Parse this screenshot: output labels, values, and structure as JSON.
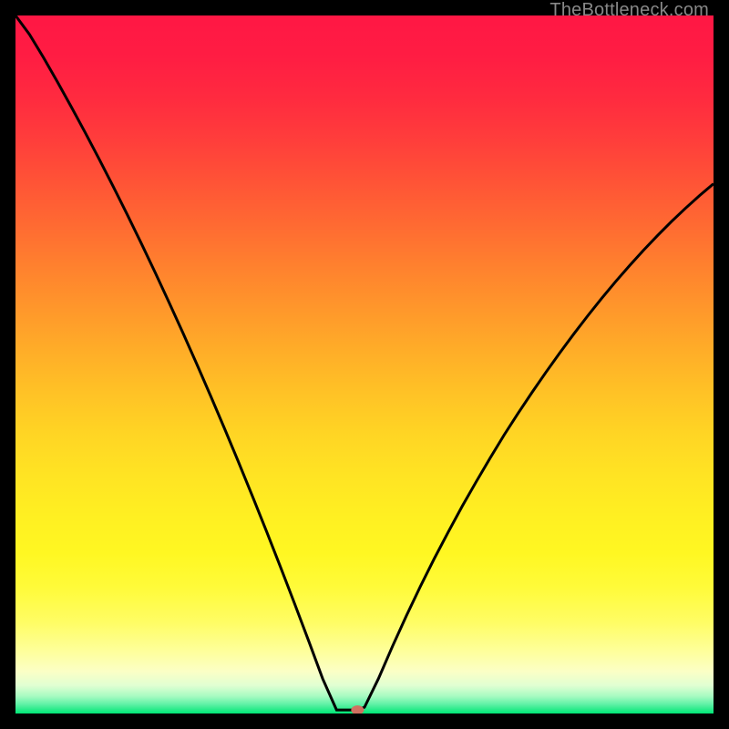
{
  "watermark": "TheBottleneck.com",
  "chart_data": {
    "type": "line",
    "title": "",
    "xlabel": "",
    "ylabel": "",
    "xlim": [
      0,
      100
    ],
    "ylim": [
      0,
      100
    ],
    "grid": false,
    "legend": false,
    "background_gradient": {
      "stops": [
        {
          "offset": 0.0,
          "color": "#ff1744"
        },
        {
          "offset": 0.06,
          "color": "#ff1d43"
        },
        {
          "offset": 0.12,
          "color": "#ff2b3f"
        },
        {
          "offset": 0.18,
          "color": "#ff3e3b"
        },
        {
          "offset": 0.24,
          "color": "#ff5436"
        },
        {
          "offset": 0.3,
          "color": "#ff6a32"
        },
        {
          "offset": 0.36,
          "color": "#ff812e"
        },
        {
          "offset": 0.42,
          "color": "#ff972b"
        },
        {
          "offset": 0.48,
          "color": "#ffad28"
        },
        {
          "offset": 0.54,
          "color": "#ffc226"
        },
        {
          "offset": 0.6,
          "color": "#ffd524"
        },
        {
          "offset": 0.66,
          "color": "#ffe423"
        },
        {
          "offset": 0.72,
          "color": "#fff022"
        },
        {
          "offset": 0.77,
          "color": "#fff722"
        },
        {
          "offset": 0.82,
          "color": "#fffb3a"
        },
        {
          "offset": 0.87,
          "color": "#fffd65"
        },
        {
          "offset": 0.91,
          "color": "#feff9a"
        },
        {
          "offset": 0.94,
          "color": "#fbffc6"
        },
        {
          "offset": 0.96,
          "color": "#e0ffd2"
        },
        {
          "offset": 0.975,
          "color": "#a8fbc2"
        },
        {
          "offset": 0.987,
          "color": "#5ef1a5"
        },
        {
          "offset": 1.0,
          "color": "#00e676"
        }
      ]
    },
    "series": [
      {
        "name": "bottleneck-curve",
        "color": "#000000",
        "width": 3,
        "x": [
          0,
          2,
          4,
          6,
          8,
          10,
          12,
          14,
          16,
          18,
          20,
          22,
          24,
          26,
          28,
          30,
          32,
          34,
          36,
          38,
          40,
          42,
          44,
          46,
          47,
          48,
          49,
          50,
          52,
          54,
          56,
          58,
          60,
          62,
          64,
          66,
          68,
          70,
          72,
          74,
          76,
          78,
          80,
          82,
          84,
          86,
          88,
          90,
          92,
          94,
          96,
          98,
          100
        ],
        "y": [
          100,
          97.3,
          94,
          90.5,
          86.9,
          83.2,
          79.4,
          75.5,
          71.5,
          67.4,
          63.2,
          58.9,
          54.5,
          50,
          45.4,
          40.7,
          35.9,
          31,
          26,
          20.9,
          15.7,
          10.4,
          5,
          0.5,
          0.5,
          0.5,
          0.5,
          0.9,
          5,
          9.6,
          14,
          18.2,
          22.2,
          26,
          29.7,
          33.2,
          36.6,
          39.9,
          43,
          46,
          48.9,
          51.7,
          54.4,
          57,
          59.5,
          61.9,
          64.2,
          66.4,
          68.5,
          70.5,
          72.4,
          74.2,
          75.9
        ]
      }
    ],
    "marker": {
      "name": "bottleneck-point",
      "x": 49,
      "y": 0.5,
      "color": "#d07060",
      "rx": 7,
      "ry": 5
    }
  },
  "colors": {
    "frame": "#000000",
    "curve": "#000000",
    "marker": "#d07060",
    "watermark": "#888888"
  }
}
